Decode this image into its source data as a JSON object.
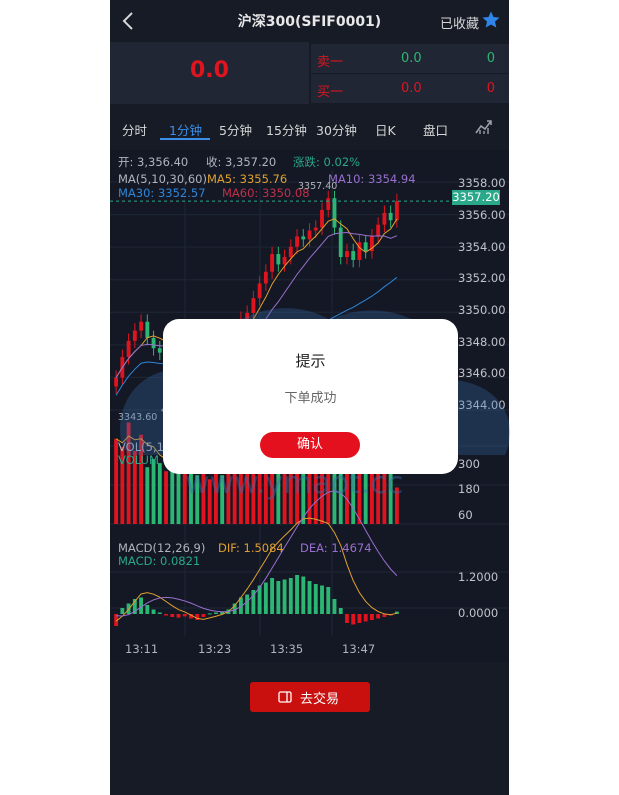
{
  "header": {
    "title": "沪深300(SFIF0001)",
    "favorite_label": "已收藏"
  },
  "quote": {
    "price": "0.0",
    "sell": {
      "label": "卖一",
      "price": "0.0",
      "volume": "0"
    },
    "buy": {
      "label": "买一",
      "price": "0.0",
      "volume": "0"
    }
  },
  "tabs": [
    {
      "label": "分时"
    },
    {
      "label": "1分钟"
    },
    {
      "label": "5分钟"
    },
    {
      "label": "15分钟"
    },
    {
      "label": "30分钟"
    },
    {
      "label": "日K"
    },
    {
      "label": "盘口"
    }
  ],
  "info": {
    "open": "开: 3,356.40",
    "close": "收: 3,357.20",
    "change": "涨跌: 0.02%",
    "ma_title": "MA(5,10,30,60)",
    "ma5": "MA5: 3355.76",
    "ma10": "MA10: 3354.94",
    "ma30": "MA30: 3352.57",
    "ma60": "MA60: 3350.08",
    "high_mark": "3357.40",
    "low_mark": "3343.60",
    "vol_title": "VOL(5,1",
    "vol_sub": "VOLUM",
    "macd_title": "MACD(12,26,9)",
    "dif": "DIF: 1.5084",
    "dea": "DEA: 1.4674",
    "macd": "MACD: 0.0821"
  },
  "price_axis": [
    "3358.00",
    "3356.00",
    "3354.00",
    "3352.00",
    "3350.00",
    "3348.00",
    "3346.00",
    "3344.00"
  ],
  "current_price": "3357.20",
  "vol_axis": [
    "300",
    "180",
    "60"
  ],
  "macd_axis": [
    "1.2000",
    "0.0000"
  ],
  "time_axis": [
    "13:11",
    "13:23",
    "13:35",
    "13:47"
  ],
  "trade_button": "去交易",
  "watermark": {
    "text": "源码平台",
    "url": "www.ymaot.cc"
  },
  "modal": {
    "title": "提示",
    "message": "下单成功",
    "confirm": "确认"
  },
  "colors": {
    "up": "#e0141e",
    "down": "#2bb673",
    "accent": "#3b8ee8",
    "ma5": "#e0a030",
    "ma10": "#9a6fcf",
    "ma30": "#2f86d8",
    "ma60": "#c0304a"
  },
  "chart_data": {
    "type": "candlestick",
    "x": [
      "13:11",
      "13:12",
      "13:13",
      "13:14",
      "13:15",
      "13:16",
      "13:17",
      "13:18",
      "13:19",
      "13:20",
      "13:21",
      "13:22",
      "13:23",
      "13:24",
      "13:25",
      "13:26",
      "13:27",
      "13:28",
      "13:29",
      "13:30",
      "13:31",
      "13:32",
      "13:33",
      "13:34",
      "13:35",
      "13:36",
      "13:37",
      "13:38",
      "13:39",
      "13:40",
      "13:41",
      "13:42",
      "13:43",
      "13:44",
      "13:45",
      "13:46",
      "13:47",
      "13:48",
      "13:49",
      "13:50",
      "13:51",
      "13:52",
      "13:53",
      "13:54",
      "13:55",
      "13:56"
    ],
    "close": [
      3345.2,
      3346.6,
      3347.7,
      3348.4,
      3349.0,
      3347.9,
      3347.2,
      3346.9,
      3347.3,
      3346.8,
      3346.4,
      3346.9,
      3346.6,
      3346.2,
      3346.9,
      3347.1,
      3347.6,
      3347.2,
      3347.9,
      3348.6,
      3349.2,
      3349.6,
      3350.6,
      3351.6,
      3352.4,
      3353.6,
      3352.9,
      3353.4,
      3354.1,
      3354.8,
      3354.6,
      3355.2,
      3355.4,
      3356.6,
      3357.4,
      3355.4,
      3353.4,
      3353.8,
      3353.2,
      3354.4,
      3353.8,
      3354.8,
      3355.6,
      3356.4,
      3355.9,
      3357.2
    ],
    "vol": [
      210,
      190,
      250,
      180,
      220,
      140,
      160,
      150,
      130,
      170,
      150,
      160,
      140,
      120,
      150,
      110,
      130,
      120,
      160,
      190,
      230,
      170,
      150,
      180,
      200,
      240,
      210,
      180,
      190,
      220,
      250,
      210,
      200,
      230,
      270,
      220,
      260,
      240,
      180,
      200,
      190,
      230,
      210,
      180,
      200,
      90
    ],
    "macd_hist": [
      -0.4,
      0.2,
      0.35,
      0.5,
      0.55,
      0.3,
      0.15,
      0.05,
      -0.05,
      -0.1,
      -0.12,
      -0.08,
      -0.15,
      -0.2,
      -0.1,
      0.02,
      0.05,
      0.08,
      0.15,
      0.35,
      0.55,
      0.65,
      0.8,
      0.95,
      1.05,
      1.2,
      1.1,
      1.15,
      1.2,
      1.3,
      1.25,
      1.1,
      1.0,
      0.95,
      0.9,
      0.5,
      0.2,
      -0.3,
      -0.35,
      -0.3,
      -0.25,
      -0.2,
      -0.15,
      -0.1,
      -0.05,
      0.08
    ],
    "price_ylim": [
      3343.0,
      3358.5
    ],
    "vol_ylim": [
      0,
      340
    ],
    "macd_ylim": [
      -0.6,
      2.4
    ]
  }
}
